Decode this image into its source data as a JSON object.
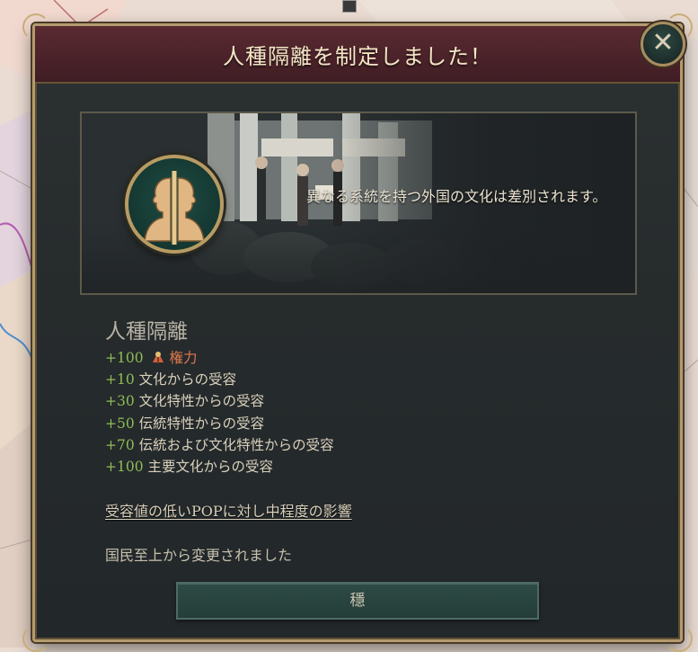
{
  "dialog": {
    "title": "人種隔離を制定しました！",
    "close_symbol": "✕",
    "description": "異なる系統を持つ外国の文化は差別されます。",
    "law_name": "人種隔離",
    "effects": [
      {
        "value": "+100",
        "label": "権力",
        "icon": "authority-icon",
        "highlight": true
      },
      {
        "value": "+10",
        "label": "文化からの受容"
      },
      {
        "value": "+30",
        "label": "文化特性からの受容"
      },
      {
        "value": "+50",
        "label": "伝統特性からの受容"
      },
      {
        "value": "+70",
        "label": "伝統および文化特性からの受容"
      },
      {
        "value": "+100",
        "label": "主要文化からの受容"
      }
    ],
    "impact_text": "受容値の低いPOPに対し中程度の影響",
    "changed_from": "国民至上から変更されました",
    "ok_label": "穩"
  },
  "colors": {
    "header": "#4a2229",
    "panel": "#262b2c",
    "border_gold": "#b49a6e",
    "positive_value": "#8ebd57",
    "authority": "#e07a4f",
    "button": "#2e4b46"
  },
  "icons": [
    "close-icon",
    "law-racial-segregation-icon",
    "authority-icon",
    "map-background"
  ]
}
